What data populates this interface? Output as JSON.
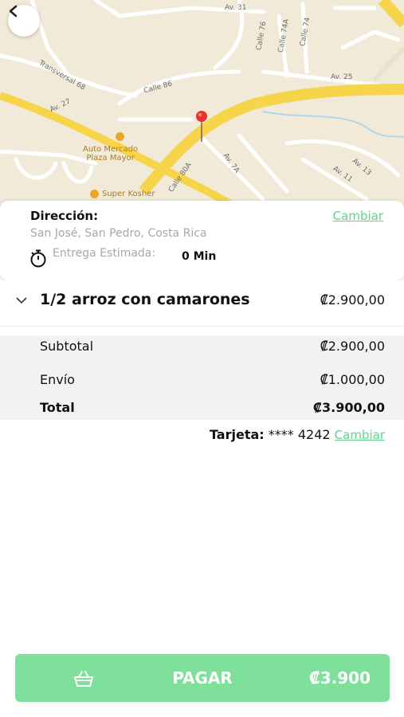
{
  "map": {
    "streets": [
      "Av. 31",
      "Transversal 68",
      "Av. 27",
      "Calle 86",
      "Calle 76",
      "Calle 74A",
      "Calle 74",
      "Av. 25",
      "Calle 80A",
      "Av. 7A",
      "Av. 13",
      "Av. 11"
    ],
    "pois": [
      "Auto Mercado\nPlaza Mayor",
      "Super Kosher"
    ]
  },
  "address_card": {
    "title": "Dirección:",
    "change_label": "Cambiar",
    "address": "San José, San Pedro, Costa Rica",
    "eta_label": "Entrega Estimada:",
    "eta_value": "0 Min"
  },
  "order": {
    "items": [
      {
        "name": "1/2 arroz con camarones",
        "price": "₡2.900,00"
      }
    ]
  },
  "summary": {
    "subtotal_label": "Subtotal",
    "subtotal_value": "₡2.900,00",
    "shipping_label": "Envío",
    "shipping_value": "₡1.000,00",
    "total_label": "Total",
    "total_value": "₡3.900,00"
  },
  "payment": {
    "card_label": "Tarjeta:",
    "card_number": "**** 4242",
    "change_label": "Cambiar"
  },
  "pay_button": {
    "label": "PAGAR",
    "amount": "₡3.900"
  },
  "colors": {
    "accent": "#5fd48a",
    "button": "#7fe09b",
    "map_bg": "#f1ead8",
    "main_road": "#f7d54a"
  },
  "icons": [
    "back-arrow-icon",
    "map-pin-icon",
    "stopwatch-icon",
    "chevron-down-icon",
    "basket-icon"
  ]
}
